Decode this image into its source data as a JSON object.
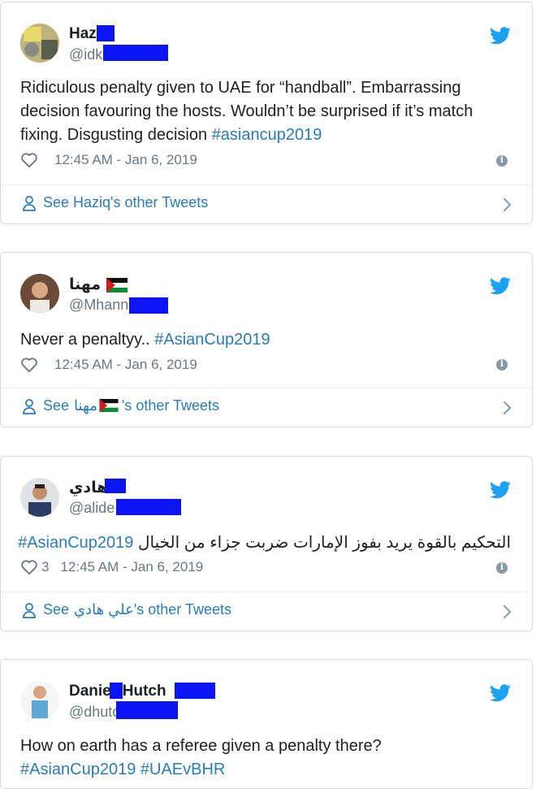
{
  "tweets": [
    {
      "name": "Haz",
      "handle": "@idk",
      "text_parts": [
        "Ridiculous penalty given to UAE for “handball”. Embarrassing decision favouring the hosts. Wouldn’t be surprised if it’s match fixing. Disgusting decision "
      ],
      "hashtag": "#asiancup2019",
      "likes": "",
      "time": "12:45 AM - Jan 6, 2019",
      "see_prefix": "See Haziq's other Tweets"
    },
    {
      "name": "مهنا",
      "handle": "@Mhann",
      "text_parts": [
        "Never a penaltyy.. "
      ],
      "hashtag": "#AsianCup2019",
      "likes": "",
      "time": "12:45 AM - Jan 6, 2019",
      "see_prefix": "See",
      "see_name": "مهنا",
      "see_suffix": "'s other Tweets"
    },
    {
      "name": "هادي",
      "handle": "@alide",
      "hashtag": "#AsianCup2019",
      "arabic_text": "التحكيم بالقوة يريد بفوز الإمارات ضربت جزاء من الخيال",
      "likes": "3",
      "time": "12:45 AM - Jan 6, 2019",
      "see_prefix": "See",
      "see_name": "علي هادي",
      "see_suffix": "'s other Tweets"
    },
    {
      "name_a": "Danie",
      "name_b": "Hutch",
      "handle": "@dhutc",
      "text_line1": "How on earth has a referee given a penalty there?",
      "hashtags_line2": "#AsianCup2019 #UAEvBHR"
    }
  ],
  "colors": {
    "link": "#2b7bb9",
    "redaction": "#0a14f5",
    "muted": "#697882",
    "twitter_blue": "#1da1f2"
  }
}
